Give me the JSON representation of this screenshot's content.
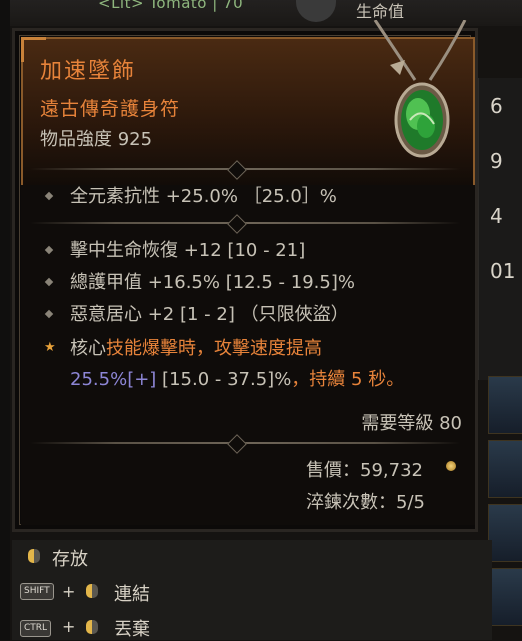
{
  "background": {
    "top_text": "<Lit> Tomato | 70",
    "top_right_text": "生命值",
    "side_numbers": [
      "6",
      "9",
      "4",
      "01"
    ]
  },
  "item": {
    "name": "加速墜飾",
    "type": "遠古傳奇護身符",
    "power": "物品強度 925",
    "implicit": "全元素抗性 +25.0% ［25.0］%",
    "affixes": [
      "擊中生命恢復 +12 [10 - 21]",
      "總護甲值 +16.5% [12.5 - 19.5]%",
      "惡意居心 +2 [1 - 2] （只限俠盜）"
    ],
    "aspect": {
      "prefix": "核心",
      "orange1": "技能爆擊時，攻擊速度提高",
      "value": "25.5%",
      "plus": "[+]",
      "range": " [15.0 - 37.5]%",
      "orange2": "，持續 5 秒。"
    },
    "required_level": "需要等級 80",
    "sell_price": "售價：59,732",
    "temper": "淬鍊次數：5/5"
  },
  "actions": {
    "stash": "存放",
    "shift_key": "SHIFT",
    "link": "連結",
    "ctrl_key": "CTRL",
    "discard": "丟棄",
    "plus": "+"
  },
  "colors": {
    "legendary_orange": "#e7833a",
    "value_blue": "#8d86d6",
    "text": "#c7c2b6"
  }
}
